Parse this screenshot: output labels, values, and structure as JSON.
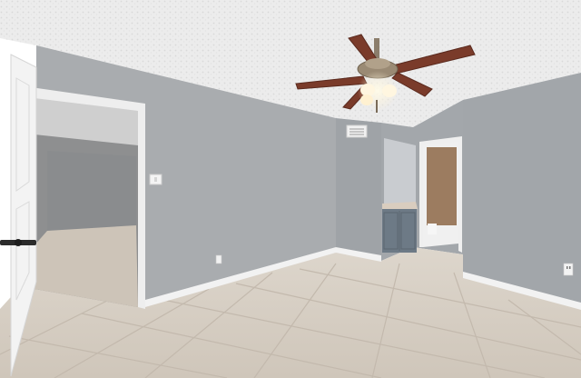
{
  "colors": {
    "wall": "#a7aaad",
    "wall_dark": "#8f9397",
    "ceiling": "#ececec",
    "tile": "#d9d2c8",
    "tile_grout": "#c4bbb0",
    "baseboard": "#f1f1f1",
    "door": "#f3f3f3",
    "cabinet": "#6d7a86",
    "blade": "#7a3b2a",
    "fan_metal": "#8b7d6b",
    "light_glow": "#fff3d6",
    "bathroom_wall": "#9c7c60"
  },
  "icons": {
    "ceiling_fan": "ceiling-fan-icon",
    "light_switch": "light-switch-icon",
    "outlet": "outlet-icon",
    "air_vent": "air-vent-icon",
    "door_handle": "door-handle-icon"
  }
}
